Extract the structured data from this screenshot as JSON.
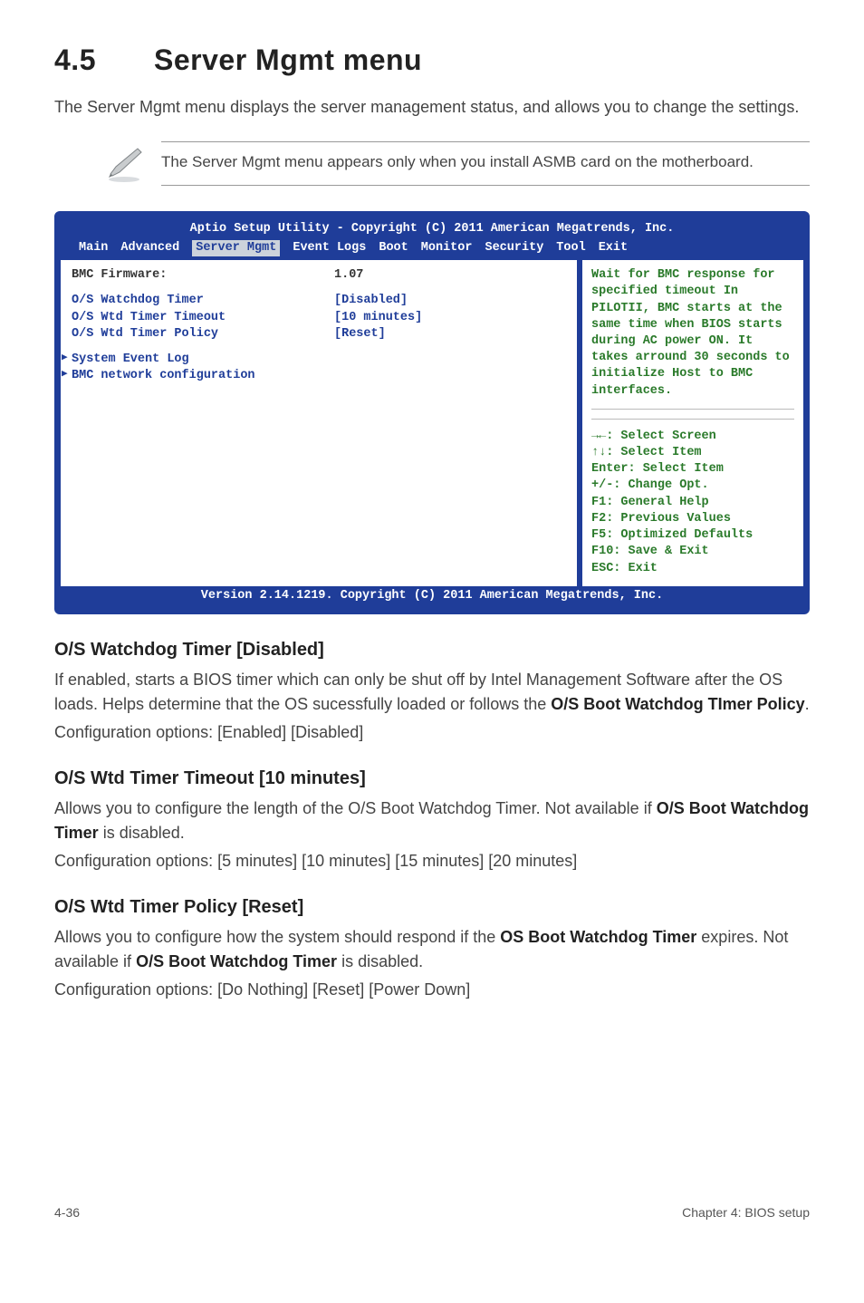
{
  "heading": {
    "num": "4.5",
    "title": "Server Mgmt menu"
  },
  "intro": "The Server Mgmt menu displays the server management status, and allows you to change the settings.",
  "note": "The Server Mgmt menu appears only when you install ASMB card on the motherboard.",
  "bios": {
    "title": "Aptio Setup Utility - Copyright (C) 2011 American Megatrends, Inc.",
    "menu": [
      "Main",
      "Advanced",
      "Server Mgmt",
      "Event Logs",
      "Boot",
      "Monitor",
      "Security",
      "Tool",
      "Exit"
    ],
    "menu_active": "Server Mgmt",
    "left": {
      "firmware_label": "BMC Firmware:",
      "firmware_value": "1.07",
      "rows": [
        {
          "label": "O/S Watchdog Timer",
          "value": "[Disabled]"
        },
        {
          "label": "O/S Wtd Timer Timeout",
          "value": "[10 minutes]"
        },
        {
          "label": "O/S Wtd Timer Policy",
          "value": "[Reset]"
        }
      ],
      "links": [
        "System Event Log",
        "BMC network configuration"
      ]
    },
    "right": {
      "help": "Wait for BMC response for specified timeout In PILOTII, BMC starts at the same time when BIOS starts during AC power ON. It takes arround 30 seconds to initialize Host to BMC interfaces.",
      "keys": [
        "→←: Select Screen",
        "↑↓:  Select Item",
        "Enter: Select Item",
        "+/-: Change Opt.",
        "F1: General Help",
        "F2: Previous Values",
        "F5: Optimized Defaults",
        "F10: Save & Exit",
        "ESC: Exit"
      ]
    },
    "footer": "Version 2.14.1219. Copyright (C) 2011 American Megatrends, Inc."
  },
  "sections": [
    {
      "heading": "O/S Watchdog Timer [Disabled]",
      "paras": [
        {
          "runs": [
            {
              "t": "If enabled, starts a BIOS timer which can only be shut off by Intel Management Software after the OS loads. Helps determine that the OS sucessfully loaded or follows the "
            },
            {
              "t": "O/S Boot Watchdog TImer Policy",
              "b": true
            },
            {
              "t": "."
            }
          ]
        },
        {
          "runs": [
            {
              "t": "Configuration options: [Enabled] [Disabled]"
            }
          ]
        }
      ]
    },
    {
      "heading": "O/S Wtd Timer Timeout [10 minutes]",
      "paras": [
        {
          "runs": [
            {
              "t": "Allows you to configure the length of the O/S Boot Watchdog Timer. Not available if "
            },
            {
              "t": "O/S Boot Watchdog Timer",
              "b": true
            },
            {
              "t": " is disabled."
            }
          ]
        },
        {
          "runs": [
            {
              "t": "Configuration options: [5 minutes] [10 minutes] [15 minutes] [20 minutes]"
            }
          ]
        }
      ]
    },
    {
      "heading": "O/S Wtd Timer Policy [Reset]",
      "paras": [
        {
          "runs": [
            {
              "t": "Allows you to configure how the system should respond if the "
            },
            {
              "t": "OS Boot Watchdog Timer",
              "b": true
            },
            {
              "t": " expires. Not available if "
            },
            {
              "t": "O/S Boot Watchdog Timer",
              "b": true
            },
            {
              "t": " is disabled."
            }
          ]
        },
        {
          "runs": [
            {
              "t": "Configuration options: [Do Nothing] [Reset] [Power Down]"
            }
          ]
        }
      ]
    }
  ],
  "footer": {
    "left": "4-36",
    "right": "Chapter 4: BIOS setup"
  }
}
